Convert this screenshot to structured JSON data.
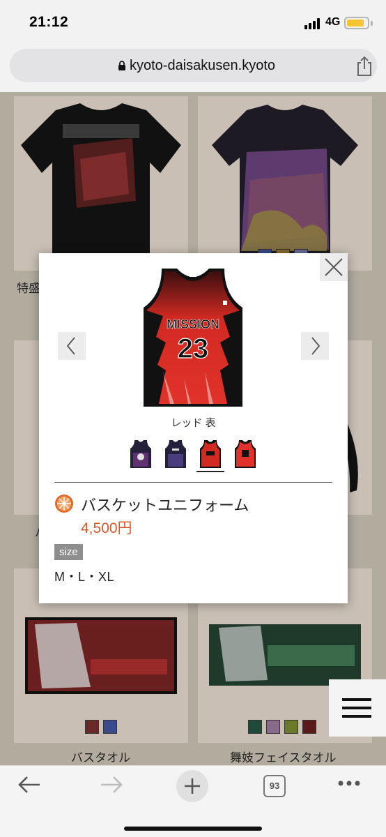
{
  "status": {
    "time": "21:12",
    "network": "4G"
  },
  "browser": {
    "url": "kyoto-daisakusen.kyoto",
    "tab_count": "93"
  },
  "grid": {
    "items": [
      {
        "label": "特盛"
      },
      {
        "label": ""
      },
      {
        "label": "バ"
      },
      {
        "label": ""
      },
      {
        "label": "バスタオル"
      },
      {
        "label": "舞妓フェイスタオル"
      }
    ]
  },
  "modal": {
    "variant_label": "レッド 表",
    "product_name": "バスケットユニフォーム",
    "price": "4,500円",
    "size_label": "size",
    "sizes": "M・L・XL",
    "jersey_text": "MISSION",
    "jersey_number": "23",
    "thumbnails": [
      {
        "name": "navy-front"
      },
      {
        "name": "navy-back"
      },
      {
        "name": "red-front",
        "selected": true
      },
      {
        "name": "red-back"
      }
    ]
  },
  "colors": {
    "accent": "#d4592d",
    "overlay": "#b1ac9e",
    "battery": "#f6c530"
  },
  "icons": [
    "lock-icon",
    "share-icon",
    "close-icon",
    "chevron-left-icon",
    "chevron-right-icon",
    "orange-slice-icon",
    "hamburger-menu-icon",
    "back-arrow-icon",
    "forward-arrow-icon",
    "plus-icon",
    "more-icon"
  ]
}
